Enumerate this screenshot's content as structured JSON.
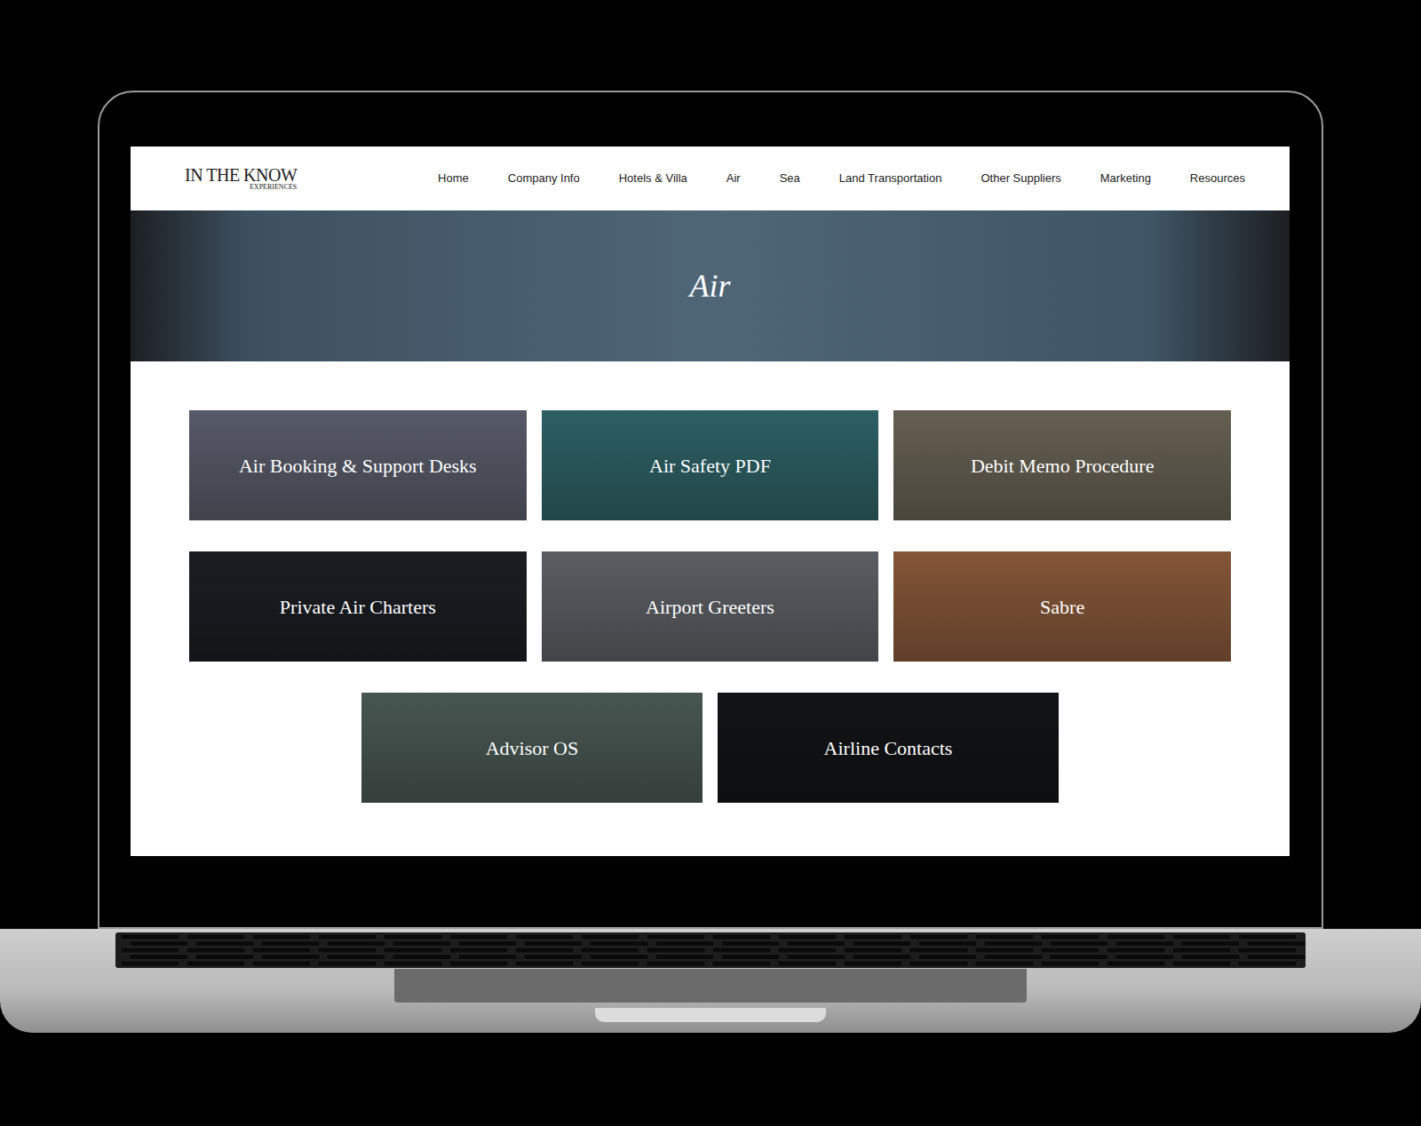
{
  "site": {
    "logo": {
      "main": "IN THE KNOW",
      "sub": "EXPERIENCES"
    },
    "nav": [
      {
        "label": "Home"
      },
      {
        "label": "Company Info"
      },
      {
        "label": "Hotels & Villa"
      },
      {
        "label": "Air"
      },
      {
        "label": "Sea"
      },
      {
        "label": "Land Transportation"
      },
      {
        "label": "Other Suppliers"
      },
      {
        "label": "Marketing"
      },
      {
        "label": "Resources"
      }
    ],
    "hero": {
      "title": "Air"
    },
    "cards": [
      {
        "title": "Air Booking & Support Desks",
        "color": "#5b5e6c"
      },
      {
        "title": "Air Safety PDF",
        "color": "#2f6468"
      },
      {
        "title": "Debit Memo Procedure",
        "color": "#6a6456"
      },
      {
        "title": "Private Air Charters",
        "color": "#1b1e23"
      },
      {
        "title": "Airport Greeters",
        "color": "#5f6267"
      },
      {
        "title": "Sabre",
        "color": "#8a5a3a"
      },
      {
        "title": "Advisor OS",
        "color": "#4b5a55"
      },
      {
        "title": "Airline Contacts",
        "color": "#131417"
      }
    ]
  }
}
